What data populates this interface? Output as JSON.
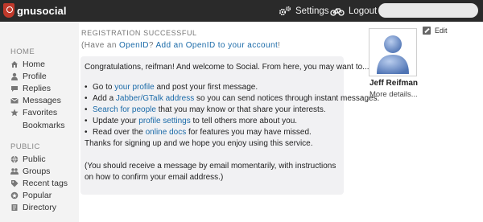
{
  "topbar": {
    "logo_text": "gnusocial",
    "settings_label": "Settings",
    "logout_label": "Logout",
    "search_placeholder": ""
  },
  "sidebar": {
    "home_title": "HOME",
    "home_items": [
      {
        "label": "Home",
        "icon": "house-icon"
      },
      {
        "label": "Profile",
        "icon": "user-icon"
      },
      {
        "label": "Replies",
        "icon": "reply-icon"
      },
      {
        "label": "Messages",
        "icon": "envelope-icon"
      },
      {
        "label": "Favorites",
        "icon": "star-icon"
      },
      {
        "label": "Bookmarks",
        "icon": ""
      }
    ],
    "public_title": "PUBLIC",
    "public_items": [
      {
        "label": "Public",
        "icon": "globe-icon"
      },
      {
        "label": "Groups",
        "icon": "group-icon"
      },
      {
        "label": "Recent tags",
        "icon": "tag-icon"
      },
      {
        "label": "Popular",
        "icon": "popular-icon"
      },
      {
        "label": "Directory",
        "icon": "directory-icon"
      }
    ]
  },
  "main": {
    "registration_title": "REGISTRATION SUCCESSFUL",
    "openid": {
      "prefix": "(Have an ",
      "link1": "OpenID",
      "middle": "? ",
      "link2": "Add an OpenID to your account",
      "suffix": "!"
    },
    "welcome_text": "Congratulations, reifman! And welcome to Social. From here, you may want to...",
    "items": [
      {
        "pre": "Go to ",
        "link": "your profile",
        "post": " and post your first message."
      },
      {
        "pre": "Add a ",
        "link": "Jabber/GTalk address",
        "post": " so you can send notices through instant messages."
      },
      {
        "pre": "",
        "link": "Search for people",
        "post": " that you may know or that share your interests."
      },
      {
        "pre": "Update your ",
        "link": "profile settings",
        "post": " to tell others more about you."
      },
      {
        "pre": "Read over the ",
        "link": "online docs",
        "post": " for features you may have missed."
      }
    ],
    "thanks": "Thanks for signing up and we hope you enjoy using this service.",
    "note": "(You should receive a message by email momentarily, with instructions on how to confirm your email address.)"
  },
  "profile": {
    "name": "Jeff Reifman",
    "more_details": "More details...",
    "edit_label": "Edit"
  },
  "colors": {
    "topbar": "#2a2a2a",
    "link": "#1a6aa8",
    "logo_red": "#c0392b",
    "avatar_blue": "#5f86c4"
  }
}
